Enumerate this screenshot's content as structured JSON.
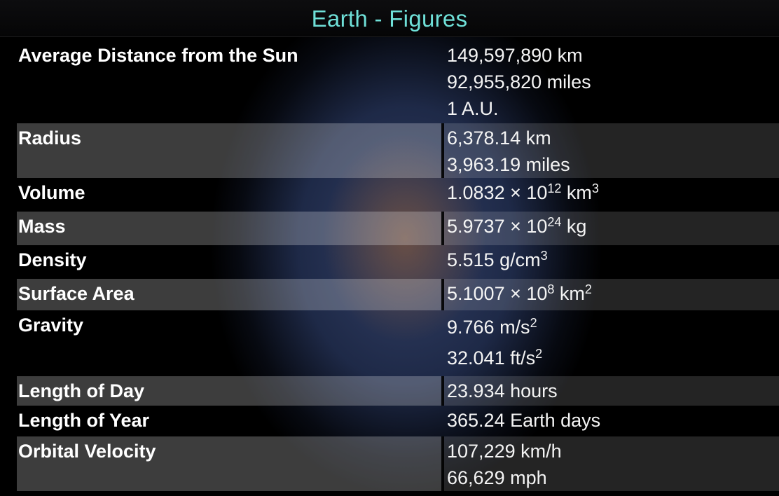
{
  "header": {
    "title": "Earth - Figures"
  },
  "rows": [
    {
      "label": "Average Distance from the Sun",
      "values": [
        "149,597,890 km",
        "92,955,820 miles",
        "1 A.U."
      ]
    },
    {
      "label": "Radius",
      "values": [
        "6,378.14 km",
        "3,963.19 miles"
      ]
    },
    {
      "label": "Volume",
      "value": {
        "base": "1.0832 × 10",
        "exp": "12",
        "unit": " km",
        "unit_exp": "3"
      }
    },
    {
      "label": "Mass",
      "value": {
        "base": "5.9737 × 10",
        "exp": "24",
        "unit": " kg"
      }
    },
    {
      "label": "Density",
      "value": {
        "base": "5.515 g/cm",
        "exp": "3"
      }
    },
    {
      "label": "Surface Area",
      "value": {
        "base": "5.1007 × 10",
        "exp": "8",
        "unit": " km",
        "unit_exp": "2"
      }
    },
    {
      "label": "Gravity",
      "values_sup": [
        {
          "base": "9.766 m/s",
          "exp": "2"
        },
        {
          "base": "32.041 ft/s",
          "exp": "2"
        }
      ]
    },
    {
      "label": "Length of Day",
      "values": [
        "23.934 hours"
      ]
    },
    {
      "label": "Length of Year",
      "values": [
        "365.24 Earth days"
      ]
    },
    {
      "label": "Orbital Velocity",
      "values": [
        "107,229 km/h",
        "66,629 mph"
      ]
    }
  ]
}
